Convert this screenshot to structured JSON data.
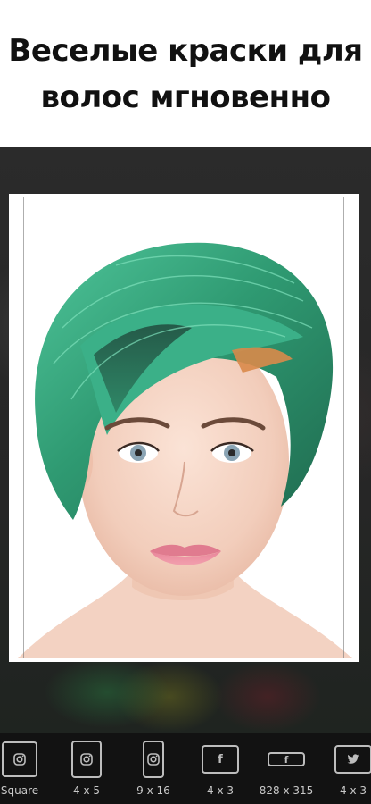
{
  "headline": {
    "line1": "Веселые краски для",
    "line2": "волос мгновенно"
  },
  "editor": {
    "photo_subject": "woman-with-green-hair",
    "hair_color": "#3fae80"
  },
  "toolbar": {
    "ratios": [
      {
        "label": "Square",
        "icon": "instagram-icon"
      },
      {
        "label": "4 x 5",
        "icon": "instagram-icon"
      },
      {
        "label": "9 x 16",
        "icon": "instagram-icon"
      },
      {
        "label": "4 x 3",
        "icon": "facebook-icon"
      },
      {
        "label": "828 x 315",
        "icon": "facebook-icon"
      },
      {
        "label": "4 x 3",
        "icon": "twitter-icon"
      }
    ]
  }
}
